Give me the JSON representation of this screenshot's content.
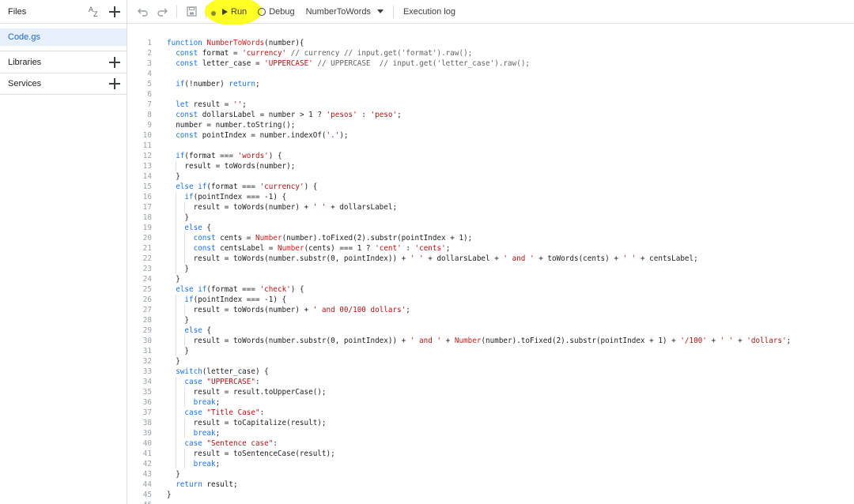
{
  "sidebar": {
    "files_title": "Files",
    "sort_icon_a": "A",
    "sort_icon_z": "Z",
    "file_name": "Code.gs",
    "libraries_label": "Libraries",
    "services_label": "Services"
  },
  "toolbar": {
    "run_label": "Run",
    "debug_label": "Debug",
    "function_selected": "NumberToWords",
    "execution_log_label": "Execution log"
  },
  "code_lines": [
    "function NumberToWords(number){",
    "  const format = 'currency' // currency // input.get('format').raw();",
    "  const letter_case = 'UPPERCASE' // UPPERCASE  // input.get('letter_case').raw();",
    "",
    "  if(!number) return;",
    "",
    "  let result = '';",
    "  const dollarsLabel = number > 1 ? 'pesos' : 'peso';",
    "  number = number.toString();",
    "  const pointIndex = number.indexOf('.');",
    "",
    "  if(format === 'words') {",
    "    result = toWords(number);",
    "  }",
    "  else if(format === 'currency') {",
    "    if(pointIndex === -1) {",
    "      result = toWords(number) + ' ' + dollarsLabel;",
    "    }",
    "    else {",
    "      const cents = Number(number).toFixed(2).substr(pointIndex + 1);",
    "      const centsLabel = Number(cents) === 1 ? 'cent' : 'cents';",
    "      result = toWords(number.substr(0, pointIndex)) + ' ' + dollarsLabel + ' and ' + toWords(cents) + ' ' + centsLabel;",
    "    }",
    "  }",
    "  else if(format === 'check') {",
    "    if(pointIndex === -1) {",
    "      result = toWords(number) + ' and 00/100 dollars';",
    "    }",
    "    else {",
    "      result = toWords(number.substr(0, pointIndex)) + ' and ' + Number(number).toFixed(2).substr(pointIndex + 1) + '/100' + ' ' + 'dollars';",
    "    }",
    "  }",
    "  switch(letter_case) {",
    "    case \"UPPERCASE\":",
    "      result = result.toUpperCase();",
    "      break;",
    "    case \"Title Case\":",
    "      result = toCapitalize(result);",
    "      break;",
    "    case \"Sentence case\":",
    "      result = toSentenceCase(result);",
    "      break;",
    "  }",
    "  return result;",
    "}",
    ""
  ]
}
